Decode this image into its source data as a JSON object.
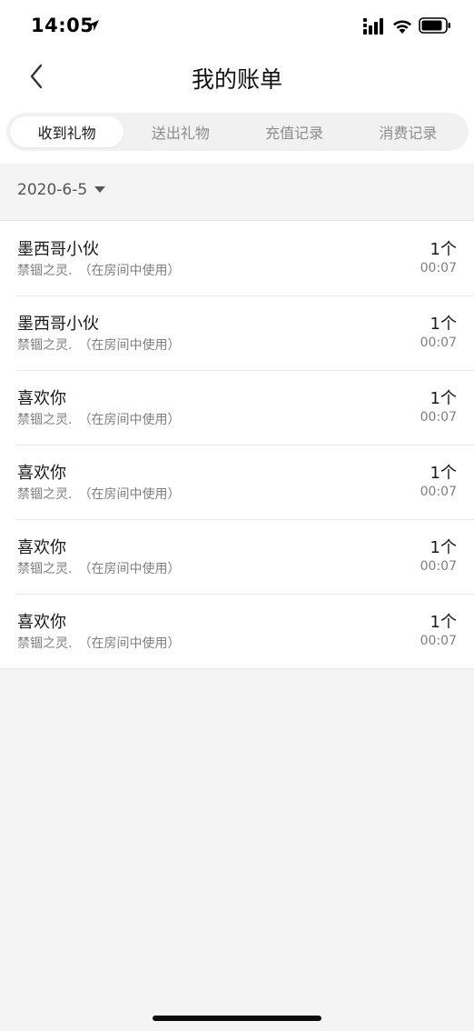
{
  "status_bar": {
    "time": "14:05"
  },
  "nav": {
    "title": "我的账单",
    "back_icon": "chevron-left-icon"
  },
  "tabs": [
    {
      "label": "收到礼物",
      "active": true
    },
    {
      "label": "送出礼物",
      "active": false
    },
    {
      "label": "充值记录",
      "active": false
    },
    {
      "label": "消费记录",
      "active": false
    }
  ],
  "filter": {
    "date": "2020-6-5"
  },
  "records": [
    {
      "title": "墨西哥小伙",
      "subtitle": "禁锢之灵.　（在房间中使用）",
      "count": "1个",
      "time": "00:07"
    },
    {
      "title": "墨西哥小伙",
      "subtitle": "禁锢之灵.　（在房间中使用）",
      "count": "1个",
      "time": "00:07"
    },
    {
      "title": "喜欢你",
      "subtitle": "禁锢之灵.　（在房间中使用）",
      "count": "1个",
      "time": "00:07"
    },
    {
      "title": "喜欢你",
      "subtitle": "禁锢之灵.　（在房间中使用）",
      "count": "1个",
      "time": "00:07"
    },
    {
      "title": "喜欢你",
      "subtitle": "禁锢之灵.　（在房间中使用）",
      "count": "1个",
      "time": "00:07"
    },
    {
      "title": "喜欢你",
      "subtitle": "禁锢之灵.　（在房间中使用）",
      "count": "1个",
      "time": "00:07"
    }
  ],
  "colors": {
    "background": "#f4f4f4",
    "text": "#1a1a1a",
    "muted": "#7f7f7f"
  }
}
